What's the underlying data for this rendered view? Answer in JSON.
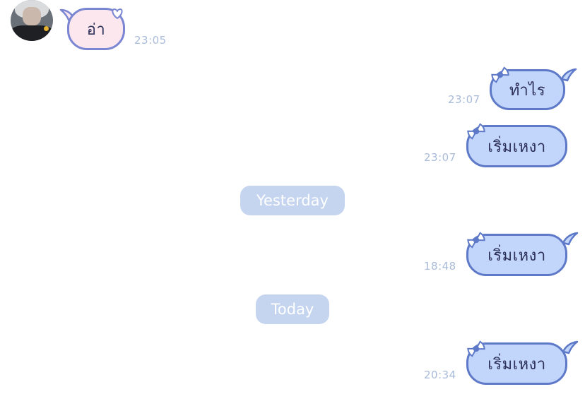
{
  "colors": {
    "outgoing_bubble": "#c2d5fb",
    "outgoing_border": "#5d79c8",
    "incoming_bubble": "#fde7ef",
    "incoming_border": "#7a86d2",
    "timestamp": "#a9bbd9",
    "date_separator": "#c5d5f0"
  },
  "contact": {
    "avatar_icon": "user-photo"
  },
  "messages": [
    {
      "direction": "incoming",
      "text": "อ่า",
      "time": "23:05",
      "decoration": "heart-icon"
    },
    {
      "direction": "outgoing",
      "text": "ทำไร",
      "time": "23:07",
      "decoration": "ribbon-bow-icon"
    },
    {
      "direction": "outgoing",
      "text": "เริ่มเหงา",
      "time": "23:07",
      "decoration": "ribbon-bow-icon"
    },
    {
      "direction": "outgoing",
      "text": "เริ่มเหงา",
      "time": "18:48",
      "decoration": "ribbon-bow-icon"
    },
    {
      "direction": "outgoing",
      "text": "เริ่มเหงา",
      "time": "20:34",
      "decoration": "ribbon-bow-icon"
    }
  ],
  "separators": {
    "yesterday": "Yesterday",
    "today": "Today"
  }
}
